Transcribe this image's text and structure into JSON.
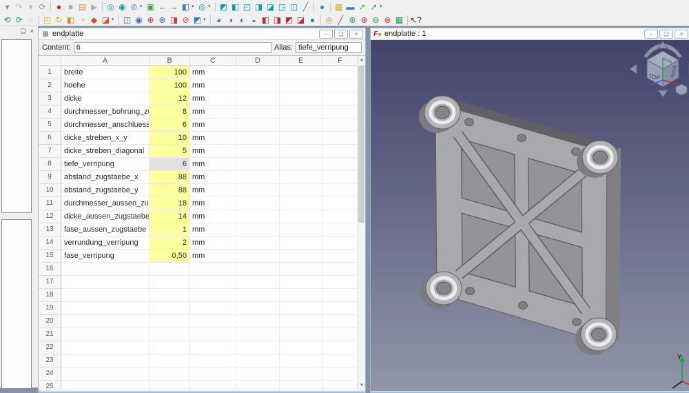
{
  "colors": {
    "cell_highlight": "#feff9e",
    "cell_selected": "#e2e2e2",
    "viewport_top": "#42426b",
    "viewport_bottom": "#9196a8",
    "part_gray": "#a9a9ad"
  },
  "toolbar": {
    "row1": [
      {
        "name": "undo-dropdown-icon",
        "glyph": "▾",
        "color": "#8a8a8a"
      },
      {
        "name": "redo-icon",
        "glyph": "↷",
        "color": "#b8b8b8"
      },
      {
        "name": "redo-dropdown-icon",
        "glyph": "▾",
        "color": "#b8b8b8"
      },
      {
        "name": "refresh-icon",
        "glyph": "⟳",
        "color": "#9a9a9a"
      },
      {
        "sep": true
      },
      {
        "name": "macro-record-icon",
        "glyph": "●",
        "color": "#d81a1a"
      },
      {
        "name": "macro-stop-icon",
        "glyph": "■",
        "color": "#ababab"
      },
      {
        "name": "macro-edit-icon",
        "glyph": "▤",
        "color": "#c9a23c"
      },
      {
        "name": "macro-play-icon",
        "glyph": "▶",
        "color": "#b4b4b4"
      },
      {
        "sep": true
      },
      {
        "name": "fit-all-icon",
        "glyph": "◎",
        "color": "#189aa0"
      },
      {
        "name": "zoom-box-icon",
        "glyph": "◉",
        "color": "#189aa0"
      },
      {
        "name": "clipping-icon",
        "glyph": "⊘",
        "color": "#4f86c6",
        "caret": true
      },
      {
        "name": "fit-selection-icon",
        "glyph": "▣",
        "color": "#3fa04a"
      },
      {
        "name": "nav-back-icon",
        "glyph": "←",
        "color": "#4a6fb5"
      },
      {
        "name": "nav-forward-icon",
        "glyph": "→",
        "color": "#4a6fb5"
      },
      {
        "name": "axonometric-icon",
        "glyph": "◧",
        "color": "#3a76c4",
        "caret": true
      },
      {
        "name": "zoom-tools-icon",
        "glyph": "◎",
        "color": "#189aa0",
        "caret": true
      },
      {
        "sep": true
      },
      {
        "name": "view-isometric-icon",
        "glyph": "◩",
        "color": "#0aa0a6"
      },
      {
        "name": "view-front-icon",
        "glyph": "◧",
        "color": "#0aa0a6"
      },
      {
        "name": "view-top-icon",
        "glyph": "◰",
        "color": "#0aa0a6"
      },
      {
        "name": "view-right-icon",
        "glyph": "◨",
        "color": "#0aa0a6"
      },
      {
        "name": "view-rear-icon",
        "glyph": "◪",
        "color": "#0aa0a6"
      },
      {
        "name": "view-bottom-icon",
        "glyph": "◲",
        "color": "#0aa0a6"
      },
      {
        "name": "view-left-icon",
        "glyph": "◫",
        "color": "#0aa0a6"
      },
      {
        "name": "measure-icon",
        "glyph": "╱",
        "color": "#2a8fb5"
      },
      {
        "sep": true
      },
      {
        "name": "sphere-icon",
        "glyph": "●",
        "color": "#2f9ab0"
      },
      {
        "sep": true
      },
      {
        "name": "part-icon",
        "glyph": "▦",
        "color": "#d8b02a"
      },
      {
        "name": "folder-icon",
        "glyph": "▬",
        "color": "#3a76c4"
      },
      {
        "name": "export-icon",
        "glyph": "↗",
        "color": "#3fa04a"
      },
      {
        "name": "export-dropdown-icon",
        "glyph": "↗",
        "color": "#3fa04a",
        "caret": true
      }
    ],
    "row2": [
      {
        "name": "rotate-left-icon",
        "glyph": "⟲",
        "color": "#2aa24a"
      },
      {
        "name": "rotate-right-icon",
        "glyph": "⟳",
        "color": "#2aa24a"
      },
      {
        "name": "appearance-icon",
        "glyph": "◌",
        "color": "#9a9a9a"
      },
      {
        "sep": true
      },
      {
        "name": "extrude-icon",
        "glyph": "◰",
        "color": "#dfae1f"
      },
      {
        "name": "revolve-icon",
        "glyph": "↻",
        "color": "#dfae1f"
      },
      {
        "name": "mirror-icon",
        "glyph": "◧",
        "color": "#e08520"
      },
      {
        "name": "scale-icon",
        "glyph": "◔",
        "color": "#dfae1f"
      },
      {
        "name": "ruled-surface-icon",
        "glyph": "◆",
        "color": "#d8502a"
      },
      {
        "name": "primitives-icon",
        "glyph": "◪",
        "color": "#d8502a",
        "caret": true
      },
      {
        "sep": true
      },
      {
        "name": "boolean-icon",
        "glyph": "◫",
        "color": "#3a6fc0"
      },
      {
        "name": "boolean-cut-icon",
        "glyph": "◉",
        "color": "#3a6fc0"
      },
      {
        "name": "boolean-union-icon",
        "glyph": "⊕",
        "color": "#c83a3a"
      },
      {
        "name": "boolean-common-icon",
        "glyph": "⊗",
        "color": "#3a6fc0"
      },
      {
        "name": "section-icon",
        "glyph": "◨",
        "color": "#c83a3a"
      },
      {
        "name": "cross-sections-icon",
        "glyph": "⊘",
        "color": "#c83a3a"
      },
      {
        "name": "compound-icon",
        "glyph": "◩",
        "color": "#3a6fc0",
        "caret": true
      },
      {
        "sep": true
      },
      {
        "name": "fillet-icon",
        "glyph": "◕",
        "color": "#3a6fc0"
      },
      {
        "name": "chamfer-icon",
        "glyph": "◑",
        "color": "#3a6fc0"
      },
      {
        "name": "thickness-icon",
        "glyph": "◐",
        "color": "#3a6fc0"
      },
      {
        "name": "offset-icon",
        "glyph": "◒",
        "color": "#3a6fc0"
      },
      {
        "name": "solid-union-icon",
        "glyph": "◧",
        "color": "#b03030"
      },
      {
        "name": "solid-cut-icon",
        "glyph": "◨",
        "color": "#b03030"
      },
      {
        "name": "solid-common-icon",
        "glyph": "◩",
        "color": "#b03030"
      },
      {
        "name": "solid-xor-icon",
        "glyph": "◪",
        "color": "#b03030"
      },
      {
        "name": "cylinder-icon",
        "glyph": "●",
        "color": "#3a7fc2"
      },
      {
        "sep": true
      },
      {
        "name": "check-geometry-icon",
        "glyph": "◎",
        "color": "#c8a23c"
      },
      {
        "name": "defeaturing-icon",
        "glyph": "╱",
        "color": "#c83a3a"
      },
      {
        "name": "refine-shape-icon",
        "glyph": "⊛",
        "color": "#2aa24a"
      },
      {
        "name": "convert-icon",
        "glyph": "⊕",
        "color": "#c83a3a"
      },
      {
        "name": "attach-icon",
        "glyph": "⊖",
        "color": "#2aa24a"
      },
      {
        "name": "reverse-icon",
        "glyph": "⊗",
        "color": "#c83a3a"
      },
      {
        "name": "validate-icon",
        "glyph": "▦",
        "color": "#2aa24a"
      },
      {
        "sep": true
      },
      {
        "name": "whats-this-icon",
        "glyph": "↖?",
        "color": "#303030"
      }
    ]
  },
  "left_panel": {
    "float_glyph": "❏",
    "close_glyph": "×"
  },
  "spreadsheet_window": {
    "title": "endplatte",
    "title_icon": "▦",
    "content_label": "Content:",
    "content_value": "6",
    "alias_label": "Alias:",
    "alias_value": "tiefe_verripung",
    "columns": [
      "A",
      "B",
      "C",
      "D",
      "E",
      "F"
    ],
    "rows": [
      {
        "n": "1",
        "name": "breite",
        "value": "100",
        "unit": "mm"
      },
      {
        "n": "2",
        "name": "hoehe",
        "value": "100",
        "unit": "mm"
      },
      {
        "n": "3",
        "name": "dicke",
        "value": "12",
        "unit": "mm"
      },
      {
        "n": "4",
        "name": "durchmesser_bohrung_zugstaebe",
        "value": "8",
        "unit": "mm"
      },
      {
        "n": "5",
        "name": "durchmesser_anschluesse",
        "value": "6",
        "unit": "mm"
      },
      {
        "n": "6",
        "name": "dicke_streben_x_y",
        "value": "10",
        "unit": "mm"
      },
      {
        "n": "7",
        "name": "dicke_streben_diagonal",
        "value": "5",
        "unit": "mm"
      },
      {
        "n": "8",
        "name": "tiefe_verripung",
        "value": "6",
        "unit": "mm",
        "selected": true
      },
      {
        "n": "9",
        "name": "abstand_zugstaebe_x",
        "value": "88",
        "unit": "mm"
      },
      {
        "n": "10",
        "name": "abstand_zugstaebe_y",
        "value": "88",
        "unit": "mm"
      },
      {
        "n": "11",
        "name": "durchmesser_aussen_zugstaebe",
        "value": "18",
        "unit": "mm"
      },
      {
        "n": "12",
        "name": "dicke_aussen_zugstaebe",
        "value": "14",
        "unit": "mm"
      },
      {
        "n": "13",
        "name": "fase_aussen_zugstaebe",
        "value": "1",
        "unit": "mm"
      },
      {
        "n": "14",
        "name": "verrundung_verripung",
        "value": "2",
        "unit": "mm"
      },
      {
        "n": "15",
        "name": "fase_verripung",
        "value": "0,50",
        "unit": "mm"
      }
    ],
    "first_empty_row": 16,
    "last_visible_row": 25,
    "buttons": {
      "minimize": "–",
      "restore": "❏",
      "close": "×"
    }
  },
  "view_window": {
    "title": "endplatte : 1",
    "buttons": {
      "minimize": "–",
      "restore": "❏",
      "close": "×"
    },
    "nav_cube": {
      "front_face_label": "TOP",
      "right_face_label": "RIGHT",
      "top_face_label": "REAR"
    },
    "axis_label_y": "Y"
  }
}
